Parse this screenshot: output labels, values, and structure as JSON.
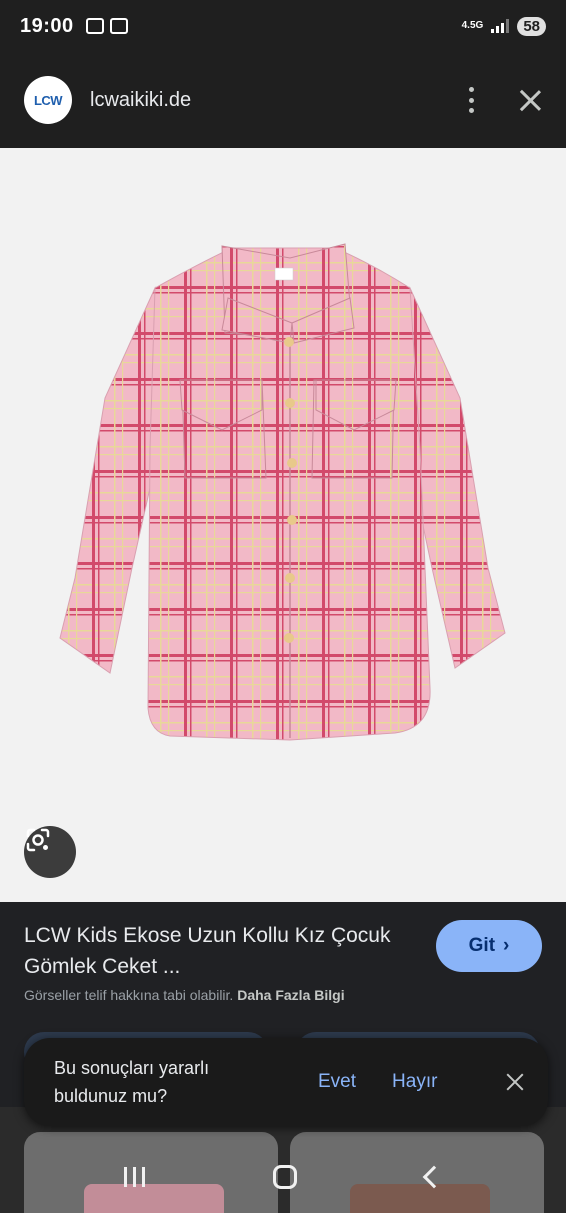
{
  "status_bar": {
    "time": "19:00",
    "network": "4.5G",
    "battery": "58"
  },
  "header": {
    "logo_text": "LCW",
    "site": "lcwaikiki.de",
    "menu_icon": "more-vert-icon",
    "close_icon": "close-icon"
  },
  "image": {
    "lens_icon": "google-lens-icon"
  },
  "result": {
    "title": "LCW Kids Ekose Uzun Kollu Kız Çocuk Gömlek Ceket ...",
    "go_label": "Git",
    "copyright_text": "Görseller telif hakkına tabi olabilir.",
    "more_info": "Daha Fazla Bilgi"
  },
  "feedback": {
    "question": "Bu sonuçları yararlı buldunuz mu?",
    "yes": "Evet",
    "no": "Hayır"
  },
  "nav": {
    "recents_icon": "recents-icon",
    "home_icon": "home-icon",
    "back_icon": "back-icon"
  },
  "colors": {
    "accent": "#8ab4f8",
    "background": "#202124",
    "shirt_pink": "#f1b8c6",
    "plaid_red": "#cc3a5c",
    "plaid_cream": "#e9dd9c"
  }
}
